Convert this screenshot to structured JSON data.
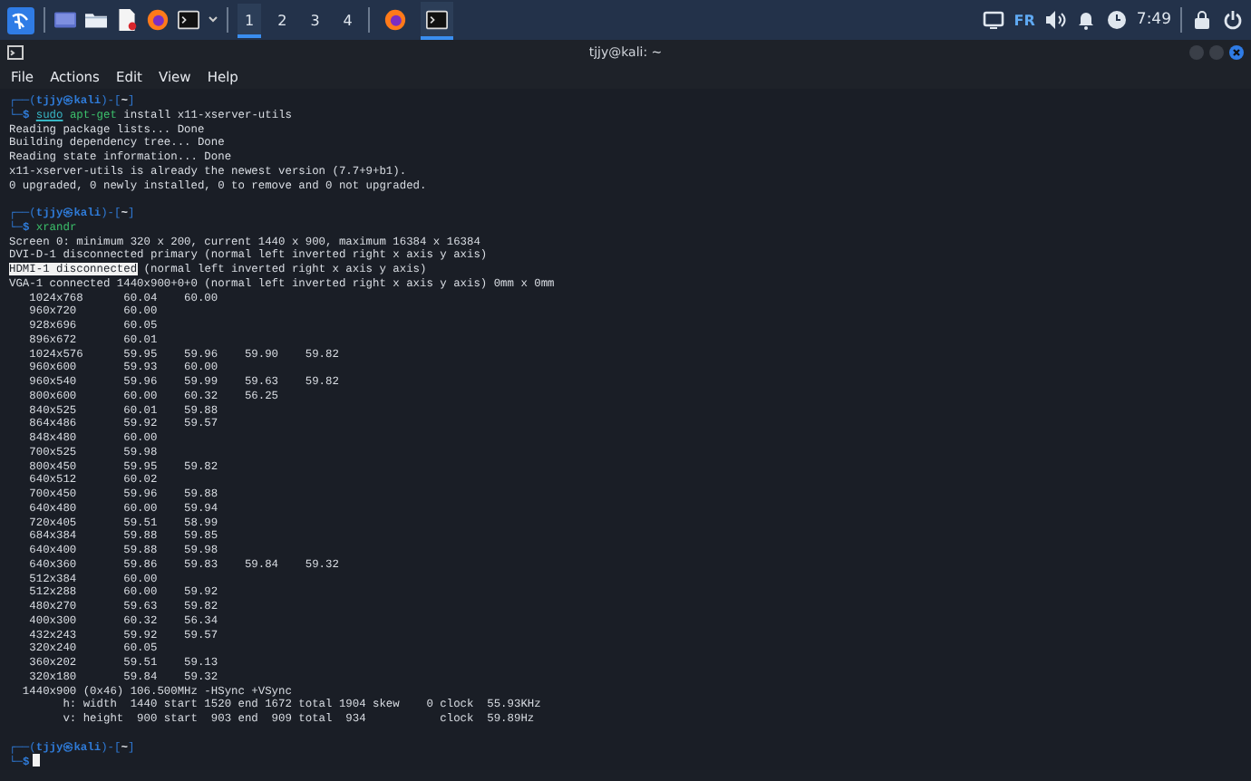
{
  "taskbar": {
    "launchers": [
      {
        "kind": "desktop"
      },
      {
        "kind": "files"
      },
      {
        "kind": "editor"
      },
      {
        "kind": "browser"
      },
      {
        "kind": "terminal"
      }
    ],
    "workspaces": [
      {
        "label": "1",
        "selected": true
      },
      {
        "label": "2",
        "selected": false
      },
      {
        "label": "3",
        "selected": false
      },
      {
        "label": "4",
        "selected": false
      }
    ],
    "tasks": [
      {
        "kind": "browser",
        "selected": false
      },
      {
        "kind": "terminal",
        "selected": true
      }
    ],
    "tray": {
      "keyboard_layout": "FR",
      "time": "7:49"
    }
  },
  "window": {
    "title": "tjjy@kali: ~",
    "menu": [
      "File",
      "Actions",
      "Edit",
      "View",
      "Help"
    ]
  },
  "terminal": {
    "blocks": [
      {
        "lines": [
          {
            "segments": [
              {
                "text": "┌──(",
                "kind": "frame"
              },
              {
                "text": "tjjy㉿kali",
                "kind": "user"
              },
              {
                "text": ")-[",
                "kind": "frame"
              },
              {
                "text": "~",
                "kind": "dir"
              },
              {
                "text": "]",
                "kind": "frame"
              }
            ]
          },
          {
            "segments": [
              {
                "text": "└─",
                "kind": "frame"
              },
              {
                "text": "$ ",
                "kind": "user"
              },
              {
                "text": "sudo",
                "kind": "sudo"
              },
              {
                "text": " apt-get",
                "kind": "program"
              },
              {
                "text": " install x11-xserver-utils",
                "kind": "plain"
              }
            ]
          },
          {
            "segments": [
              {
                "text": "Reading package lists... Done",
                "kind": "plain"
              }
            ]
          },
          {
            "segments": [
              {
                "text": "Building dependency tree... Done",
                "kind": "plain"
              }
            ]
          },
          {
            "segments": [
              {
                "text": "Reading state information... Done",
                "kind": "plain"
              }
            ]
          },
          {
            "segments": [
              {
                "text": "x11-xserver-utils is already the newest version (7.7+9+b1).",
                "kind": "plain"
              }
            ]
          },
          {
            "segments": [
              {
                "text": "0 upgraded, 0 newly installed, 0 to remove and 0 not upgraded.",
                "kind": "plain"
              }
            ]
          }
        ]
      },
      {
        "lines": [
          {
            "segments": [
              {
                "text": "┌──(",
                "kind": "frame"
              },
              {
                "text": "tjjy㉿kali",
                "kind": "user"
              },
              {
                "text": ")-[",
                "kind": "frame"
              },
              {
                "text": "~",
                "kind": "dir"
              },
              {
                "text": "]",
                "kind": "frame"
              }
            ]
          },
          {
            "segments": [
              {
                "text": "└─",
                "kind": "frame"
              },
              {
                "text": "$ ",
                "kind": "user"
              },
              {
                "text": "xrandr",
                "kind": "program"
              }
            ]
          },
          {
            "segments": [
              {
                "text": "Screen 0: minimum 320 x 200, current 1440 x 900, maximum 16384 x 16384",
                "kind": "plain"
              }
            ]
          },
          {
            "segments": [
              {
                "text": "DVI-D-1 disconnected primary (normal left inverted right x axis y axis)",
                "kind": "plain"
              }
            ]
          },
          {
            "segments": [
              {
                "text": "HDMI-1 disconnected",
                "kind": "selected"
              },
              {
                "text": " (normal left inverted right x axis y axis)",
                "kind": "plain"
              }
            ]
          },
          {
            "segments": [
              {
                "text": "VGA-1 connected 1440x900+0+0 (normal left inverted right x axis y axis) 0mm x 0mm",
                "kind": "plain"
              }
            ]
          },
          {
            "segments": [
              {
                "text": "   1024x768      60.04    60.00",
                "kind": "plain"
              }
            ]
          },
          {
            "segments": [
              {
                "text": "   960x720       60.00",
                "kind": "plain"
              }
            ]
          },
          {
            "segments": [
              {
                "text": "   928x696       60.05",
                "kind": "plain"
              }
            ]
          },
          {
            "segments": [
              {
                "text": "   896x672       60.01",
                "kind": "plain"
              }
            ]
          },
          {
            "segments": [
              {
                "text": "   1024x576      59.95    59.96    59.90    59.82",
                "kind": "plain"
              }
            ]
          },
          {
            "segments": [
              {
                "text": "   960x600       59.93    60.00",
                "kind": "plain"
              }
            ]
          },
          {
            "segments": [
              {
                "text": "   960x540       59.96    59.99    59.63    59.82",
                "kind": "plain"
              }
            ]
          },
          {
            "segments": [
              {
                "text": "   800x600       60.00    60.32    56.25",
                "kind": "plain"
              }
            ]
          },
          {
            "segments": [
              {
                "text": "   840x525       60.01    59.88",
                "kind": "plain"
              }
            ]
          },
          {
            "segments": [
              {
                "text": "   864x486       59.92    59.57",
                "kind": "plain"
              }
            ]
          },
          {
            "segments": [
              {
                "text": "   848x480       60.00",
                "kind": "plain"
              }
            ]
          },
          {
            "segments": [
              {
                "text": "   700x525       59.98",
                "kind": "plain"
              }
            ]
          },
          {
            "segments": [
              {
                "text": "   800x450       59.95    59.82",
                "kind": "plain"
              }
            ]
          },
          {
            "segments": [
              {
                "text": "   640x512       60.02",
                "kind": "plain"
              }
            ]
          },
          {
            "segments": [
              {
                "text": "   700x450       59.96    59.88",
                "kind": "plain"
              }
            ]
          },
          {
            "segments": [
              {
                "text": "   640x480       60.00    59.94",
                "kind": "plain"
              }
            ]
          },
          {
            "segments": [
              {
                "text": "   720x405       59.51    58.99",
                "kind": "plain"
              }
            ]
          },
          {
            "segments": [
              {
                "text": "   684x384       59.88    59.85",
                "kind": "plain"
              }
            ]
          },
          {
            "segments": [
              {
                "text": "   640x400       59.88    59.98",
                "kind": "plain"
              }
            ]
          },
          {
            "segments": [
              {
                "text": "   640x360       59.86    59.83    59.84    59.32",
                "kind": "plain"
              }
            ]
          },
          {
            "segments": [
              {
                "text": "   512x384       60.00",
                "kind": "plain"
              }
            ]
          },
          {
            "segments": [
              {
                "text": "   512x288       60.00    59.92",
                "kind": "plain"
              }
            ]
          },
          {
            "segments": [
              {
                "text": "   480x270       59.63    59.82",
                "kind": "plain"
              }
            ]
          },
          {
            "segments": [
              {
                "text": "   400x300       60.32    56.34",
                "kind": "plain"
              }
            ]
          },
          {
            "segments": [
              {
                "text": "   432x243       59.92    59.57",
                "kind": "plain"
              }
            ]
          },
          {
            "segments": [
              {
                "text": "   320x240       60.05",
                "kind": "plain"
              }
            ]
          },
          {
            "segments": [
              {
                "text": "   360x202       59.51    59.13",
                "kind": "plain"
              }
            ]
          },
          {
            "segments": [
              {
                "text": "   320x180       59.84    59.32",
                "kind": "plain"
              }
            ]
          },
          {
            "segments": [
              {
                "text": "  1440x900 (0x46) 106.500MHz -HSync +VSync",
                "kind": "plain"
              }
            ]
          },
          {
            "segments": [
              {
                "text": "        h: width  1440 start 1520 end 1672 total 1904 skew    0 clock  55.93KHz",
                "kind": "plain"
              }
            ]
          },
          {
            "segments": [
              {
                "text": "        v: height  900 start  903 end  909 total  934           clock  59.89Hz",
                "kind": "plain"
              }
            ]
          }
        ]
      },
      {
        "lines": [
          {
            "segments": [
              {
                "text": "┌──(",
                "kind": "frame"
              },
              {
                "text": "tjjy㉿kali",
                "kind": "user"
              },
              {
                "text": ")-[",
                "kind": "frame"
              },
              {
                "text": "~",
                "kind": "dir"
              },
              {
                "text": "]",
                "kind": "frame"
              }
            ]
          },
          {
            "segments": [
              {
                "text": "└─",
                "kind": "frame"
              },
              {
                "text": "$",
                "kind": "user"
              }
            ],
            "cursor": true
          }
        ]
      }
    ]
  }
}
